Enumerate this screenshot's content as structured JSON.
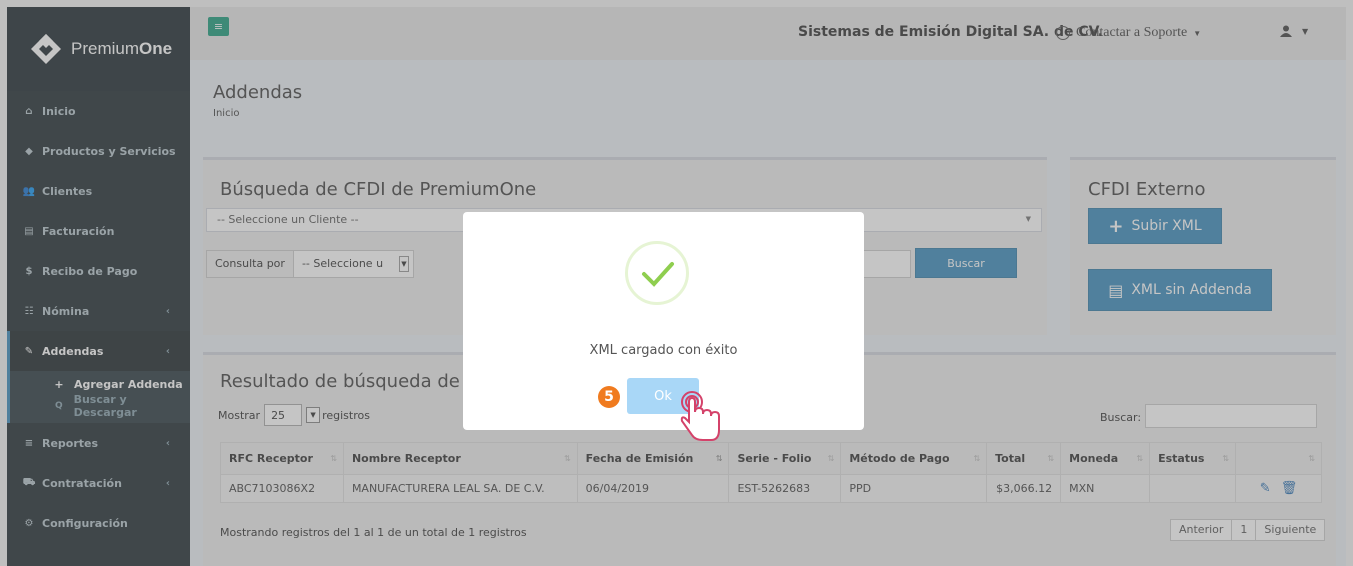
{
  "brand": {
    "name_light": "Premium",
    "name_bold": "One"
  },
  "sidebar": {
    "items": [
      {
        "label": "Inicio",
        "icon": "home-icon",
        "glyph": "⌂"
      },
      {
        "label": "Productos y Servicios",
        "icon": "tag-icon",
        "glyph": "◆"
      },
      {
        "label": "Clientes",
        "icon": "users-icon",
        "glyph": "👥"
      },
      {
        "label": "Facturación",
        "icon": "file-icon",
        "glyph": "▤"
      },
      {
        "label": "Recibo de Pago",
        "icon": "dollar-icon",
        "glyph": "$"
      },
      {
        "label": "Nómina",
        "icon": "sitemap-icon",
        "glyph": "☷"
      },
      {
        "label": "Addendas",
        "icon": "paperclip-icon",
        "glyph": "✎"
      },
      {
        "label": "Reportes",
        "icon": "list-icon",
        "glyph": "≡"
      },
      {
        "label": "Contratación",
        "icon": "cart-icon",
        "glyph": "⛟"
      },
      {
        "label": "Configuración",
        "icon": "cogs-icon",
        "glyph": "⚙"
      }
    ],
    "submenu": [
      {
        "label": "Agregar Addenda",
        "glyph": "+"
      },
      {
        "label": "Buscar y Descargar",
        "glyph": "🔍"
      }
    ]
  },
  "topbar": {
    "toggle_glyph": "≡",
    "company": "Sistemas de Emisión Digital SA. de CV.",
    "support": "Contactar a Soporte"
  },
  "header": {
    "title": "Addendas",
    "breadcrumb": "Inicio"
  },
  "search_box": {
    "title": "Búsqueda de CFDI de PremiumOne",
    "client_placeholder": "-- Seleccione un Cliente --",
    "consulta_label": "Consulta por",
    "consulta_value": "-- Seleccione u",
    "buscar_button": "Buscar"
  },
  "external_box": {
    "title": "CFDI Externo",
    "upload_button": "Subir XML",
    "no_addenda_button": "XML sin Addenda"
  },
  "results": {
    "title": "Resultado de búsqueda de",
    "show_label": "Mostrar",
    "page_size": "25",
    "records_label": "registros",
    "search_label": "Buscar:",
    "columns": [
      "RFC Receptor",
      "Nombre Receptor",
      "Fecha de Emisión",
      "Serie - Folio",
      "Método de Pago",
      "Total",
      "Moneda",
      "Estatus",
      ""
    ],
    "rows": [
      {
        "rfc": "ABC7103086X2",
        "name": "MANUFACTURERA LEAL SA. DE C.V.",
        "date": "06/04/2019",
        "serie": "EST-5262683",
        "method": "PPD",
        "total": "$3,066.12",
        "currency": "MXN",
        "status": ""
      }
    ],
    "showing_text": "Mostrando registros del 1 al 1 de un total de 1 registros",
    "pager": {
      "prev": "Anterior",
      "page": "1",
      "next": "Siguiente"
    }
  },
  "modal": {
    "message": "XML cargado con éxito",
    "ok_button": "Ok",
    "step": "5",
    "success_color": "#8fce4f"
  },
  "colors": {
    "sidebar": "#222d32",
    "primary": "#3c8dbc",
    "toggle": "#1e9d7e",
    "badge": "#f07b1f"
  }
}
